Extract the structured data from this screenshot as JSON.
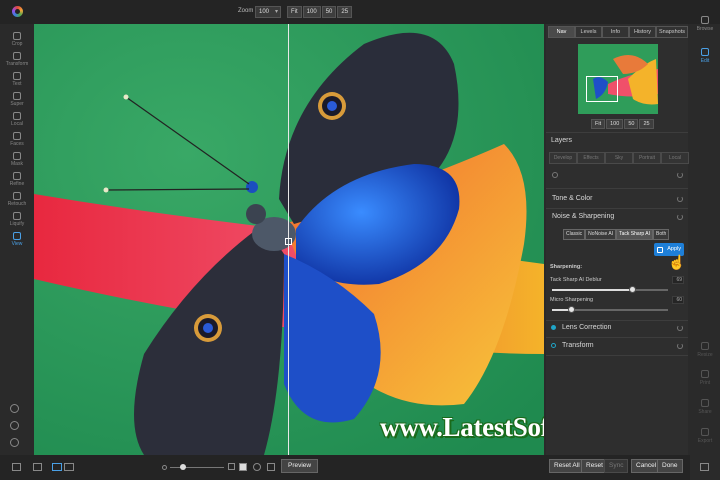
{
  "topbar": {
    "zoom_label": "Zoom",
    "zoom_value": "100",
    "zoom_buttons": [
      "Fit",
      "100",
      "50",
      "25"
    ]
  },
  "left_tools": [
    {
      "label": "Crop",
      "icon": "crop-icon"
    },
    {
      "label": "Transform",
      "icon": "move-icon"
    },
    {
      "label": "Text",
      "icon": "text-icon"
    },
    {
      "label": "Super",
      "icon": "wand-icon"
    },
    {
      "label": "Local",
      "icon": "brush-icon"
    },
    {
      "label": "Faces",
      "icon": "face-icon"
    },
    {
      "label": "Mask",
      "icon": "mask-icon"
    },
    {
      "label": "Refine",
      "icon": "refine-icon"
    },
    {
      "label": "Retouch",
      "icon": "retouch-icon"
    },
    {
      "label": "Liquify",
      "icon": "liquify-icon"
    },
    {
      "label": "View",
      "icon": "view-icon"
    }
  ],
  "panel": {
    "tabs": [
      "Nav",
      "Levels",
      "Info",
      "History",
      "Snapshots"
    ],
    "nav_zoom": [
      "Fit",
      "100",
      "50",
      "25"
    ],
    "layers_title": "Layers",
    "layer_tabs": [
      "Develop",
      "Effects",
      "Sky",
      "Portrait",
      "Local"
    ],
    "tone_color": "Tone & Color",
    "noise_sharpening": "Noise & Sharpening",
    "noise_modes": [
      "Classic",
      "NoNoise AI",
      "Tack Sharp AI",
      "Both"
    ],
    "apply_label": "Apply",
    "sharpening_label": "Sharpening:",
    "slider1_label": "Tack Sharp AI Deblur",
    "slider1_value": "69",
    "slider1_fraction": 0.69,
    "slider2_label": "Micro Sharpening",
    "slider2_value": "60",
    "slider2_fraction": 0.16,
    "lens_correction": "Lens Correction",
    "transform": "Transform"
  },
  "far_right": [
    {
      "label": "Browse",
      "icon": "browse-icon"
    },
    {
      "label": "Edit",
      "icon": "sliders-icon"
    },
    {
      "label": "Resize",
      "icon": "resize-icon"
    },
    {
      "label": "Print",
      "icon": "print-icon"
    },
    {
      "label": "Share",
      "icon": "share-icon"
    },
    {
      "label": "Export",
      "icon": "export-icon"
    }
  ],
  "bottombar": {
    "preview": "Preview",
    "reset_all": "Reset All",
    "reset": "Reset",
    "sync": "Sync",
    "cancel": "Cancel",
    "done": "Done"
  },
  "watermark": "www.LatestSoftwareCrack.com",
  "colors": {
    "accent": "#1e7fd8",
    "background": "#2a2a2a",
    "panel": "#2e2e2e"
  }
}
